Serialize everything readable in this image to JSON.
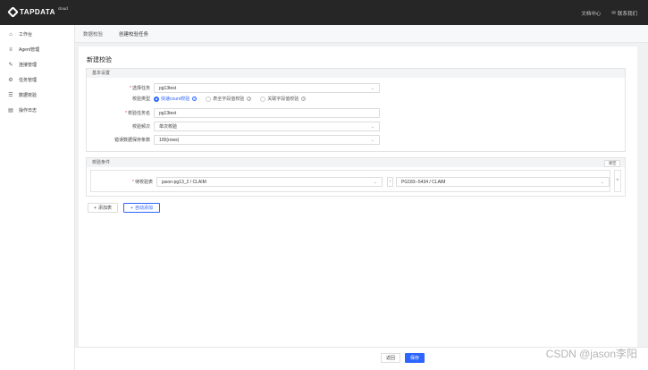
{
  "app": {
    "logo_text": "TAPDATA",
    "logo_sup": "cloud"
  },
  "topbar": {
    "docs": "文档中心",
    "contact": "联系我们"
  },
  "sidebar": {
    "items": [
      {
        "label": "工作台",
        "icon": "home-icon"
      },
      {
        "label": "Agent管理",
        "icon": "list-icon"
      },
      {
        "label": "连接管理",
        "icon": "link-icon"
      },
      {
        "label": "任务管理",
        "icon": "task-icon"
      },
      {
        "label": "数据校验",
        "icon": "check-icon"
      },
      {
        "label": "操作日志",
        "icon": "log-icon"
      }
    ]
  },
  "breadcrumb": {
    "first": "数据校验",
    "second": "创建校验任务"
  },
  "page": {
    "title": "新建校验"
  },
  "basic": {
    "title": "基本设置",
    "task_label": "选择任务",
    "task_value": "pg13test",
    "type_label": "校验类型",
    "type_options": [
      "快速count校验",
      "表全字段值校验",
      "关联字段值校验"
    ],
    "name_label": "校验任务名",
    "name_value": "pg13test",
    "freq_label": "校验频次",
    "freq_value": "单次校验",
    "store_label": "错误数据保存条数",
    "store_value": "100(rows)"
  },
  "conditions": {
    "title": "校验条件",
    "clear": "清空",
    "table_label": "待校验表",
    "source_value": "jason-pg13_2 / CLAIM",
    "target_value": "PG183--5434 / CLAIM"
  },
  "actions": {
    "add_table": "添加表",
    "auto_add": "自动添加"
  },
  "footer": {
    "back": "返回",
    "save": "保存"
  },
  "watermark": "CSDN @jason李阳"
}
